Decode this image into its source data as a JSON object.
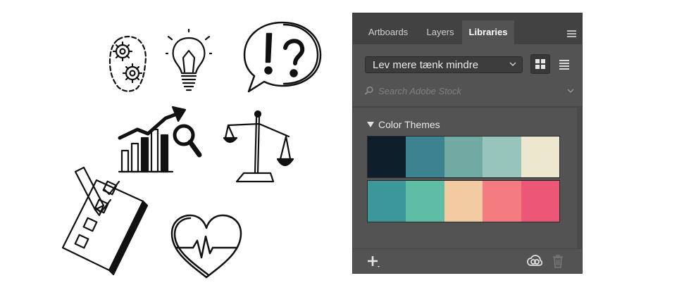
{
  "canvas": {
    "doodles": [
      {
        "name": "gears-icon"
      },
      {
        "name": "lightbulb-icon"
      },
      {
        "name": "speech-bubble-exclamation-question-icon"
      },
      {
        "name": "growth-chart-magnifier-icon"
      },
      {
        "name": "balance-scale-icon"
      },
      {
        "name": "checklist-pencil-icon"
      },
      {
        "name": "heartbeat-heart-icon"
      }
    ]
  },
  "panel": {
    "tabs": [
      {
        "label": "Artboards",
        "active": false
      },
      {
        "label": "Layers",
        "active": false
      },
      {
        "label": "Libraries",
        "active": true
      }
    ],
    "library_select": {
      "value": "Lev mere tænk mindre"
    },
    "view_mode": "grid",
    "search": {
      "placeholder": "Search Adobe Stock"
    },
    "section": {
      "title": "Color Themes",
      "expanded": true
    },
    "color_themes": [
      {
        "swatches": [
          "#0e1e2a",
          "#3d8290",
          "#71a9a3",
          "#97c5bb",
          "#ede7cf"
        ]
      },
      {
        "swatches": [
          "#3c979b",
          "#5fbca5",
          "#f3cba3",
          "#f47b7f",
          "#ec5777"
        ]
      }
    ],
    "footer": {
      "add_icon": "plus-icon",
      "sync_icon": "creative-cloud-icon",
      "delete_icon": "trash-icon"
    }
  }
}
